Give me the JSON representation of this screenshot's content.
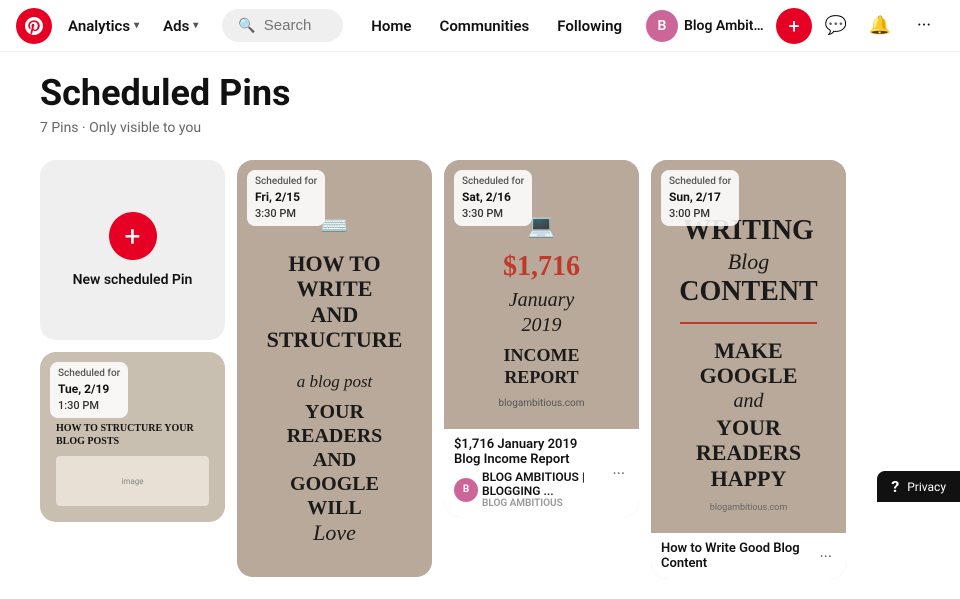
{
  "header": {
    "logo_alt": "Pinterest logo",
    "analytics_label": "Analytics",
    "ads_label": "Ads",
    "search_placeholder": "Search",
    "home_label": "Home",
    "communities_label": "Communities",
    "following_label": "Following",
    "user_name": "Blog Ambitio...",
    "add_icon": "+",
    "message_icon": "💬",
    "notification_icon": "🔔",
    "more_icon": "···"
  },
  "page": {
    "title": "Scheduled Pins",
    "subtitle": "7 Pins · Only visible to you"
  },
  "new_pin": {
    "label": "New scheduled Pin"
  },
  "pins": [
    {
      "id": "write-blog",
      "scheduled_label": "Scheduled for",
      "scheduled_date": "Fri, 2/15",
      "scheduled_time": "3:30 PM",
      "title_lines": [
        "HOW TO",
        "WRITE",
        "AND",
        "STRUCTURE"
      ],
      "subtitle": "a blog post",
      "body_lines": [
        "YOUR",
        "READERS",
        "AND",
        "GOOGLE",
        "WILL",
        "Love"
      ]
    },
    {
      "id": "income-report",
      "scheduled_label": "Scheduled for",
      "scheduled_date": "Sat, 2/16",
      "scheduled_time": "3:30 PM",
      "amount": "$1,716",
      "period": "January 2019",
      "type": "INCOME REPORT",
      "meta_title": "$1,716 January 2019 Blog Income Report",
      "meta_author": "Blog Ambitious | Blogging ...",
      "meta_brand": "BLOG AMBITIOUS"
    },
    {
      "id": "writing-content",
      "scheduled_label": "Scheduled for",
      "scheduled_date": "Sun, 2/17",
      "scheduled_time": "3:00 PM",
      "title_lines": [
        "WRITING",
        "Blog",
        "CONTENT"
      ],
      "divider": true,
      "body_lines": [
        "MAKE",
        "GOOGLE",
        "and",
        "YOUR",
        "READERS",
        "HAPPY"
      ],
      "meta_title": "How to Write Good Blog Content",
      "meta_sub": ""
    },
    {
      "id": "structure-posts",
      "scheduled_label": "Scheduled for",
      "scheduled_date": "Tue, 2/19",
      "scheduled_time": "1:30 PM",
      "title": "HOW TO STRUCTURE YOUR BLOG POSTS"
    }
  ],
  "privacy": {
    "question": "?",
    "label": "Privacy"
  }
}
